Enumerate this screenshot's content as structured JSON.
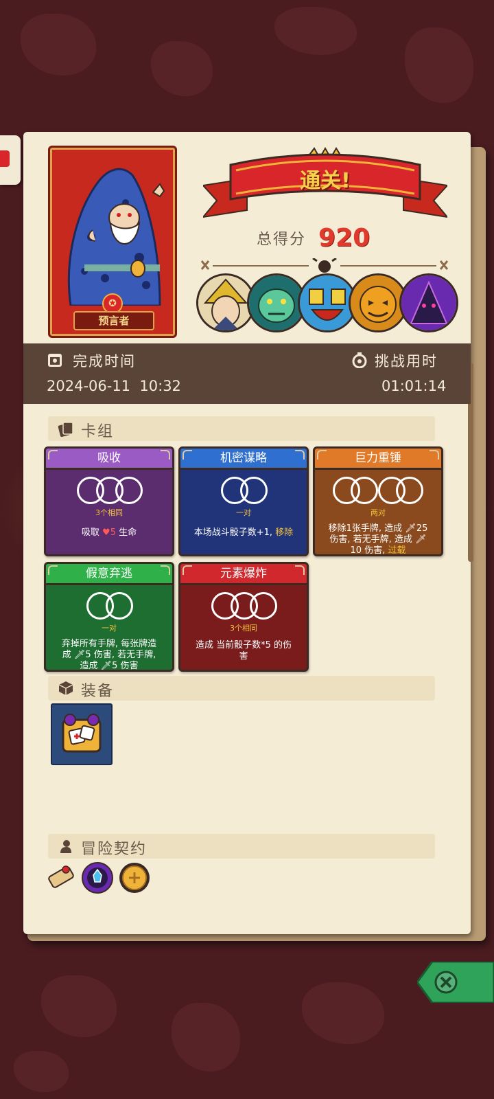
{
  "result": {
    "banner_text": "通关!",
    "score_label": "总得分",
    "score_value": "920"
  },
  "hero": {
    "name": "预言者"
  },
  "stats": {
    "finish_time_label": "完成时间",
    "finish_time_value": "2024-06-11  10:32",
    "challenge_time_label": "挑战用时",
    "challenge_time_value": "01:01:14"
  },
  "sections": {
    "deck": "卡组",
    "equipment": "装备",
    "contract": "冒险契约"
  },
  "cards": [
    {
      "title": "吸收",
      "dice": 3,
      "sub": "3个相同",
      "desc_parts": [
        "吸取 ",
        "5",
        " 生命"
      ],
      "color": "#5b2d6e",
      "head": "#9a5bc4"
    },
    {
      "title": "机密谋略",
      "dice": 2,
      "sub": "一对",
      "desc_parts": [
        "本场战斗骰子数+1, ",
        "移除"
      ],
      "color": "#21347a",
      "head": "#2f6fd0"
    },
    {
      "title": "巨力重锤",
      "dice": 4,
      "sub": "两对",
      "desc_lines": [
        "移除1张手牌, 造成 🗡25",
        "伤害, 若无手牌, 造成 🗡",
        "10 伤害, "
      ],
      "desc_tail": "过载",
      "color": "#8a4a1e",
      "head": "#e07a28"
    },
    {
      "title": "假意弃逃",
      "dice": 2,
      "sub": "一对",
      "desc_lines": [
        "弃掉所有手牌, 每张牌造",
        "成 🗡5 伤害, 若无手牌,",
        "造成 🗡5 伤害"
      ],
      "color": "#1e6e32",
      "head": "#2fb048"
    },
    {
      "title": "元素爆炸",
      "dice": 3,
      "sub": "3个相同",
      "desc_lines": [
        "造成 当前骰子数*5 的伤",
        "害"
      ],
      "color": "#7a1c1c",
      "head": "#d0282c"
    }
  ],
  "colors": {
    "accent_red": "#e03a2c",
    "panel_bg": "#f5ecd6",
    "band_bg": "#5a4438"
  },
  "icons": [
    "calendar-icon",
    "stopwatch-icon",
    "cards-icon",
    "dice-box-icon",
    "contract-icon",
    "close-icon"
  ]
}
